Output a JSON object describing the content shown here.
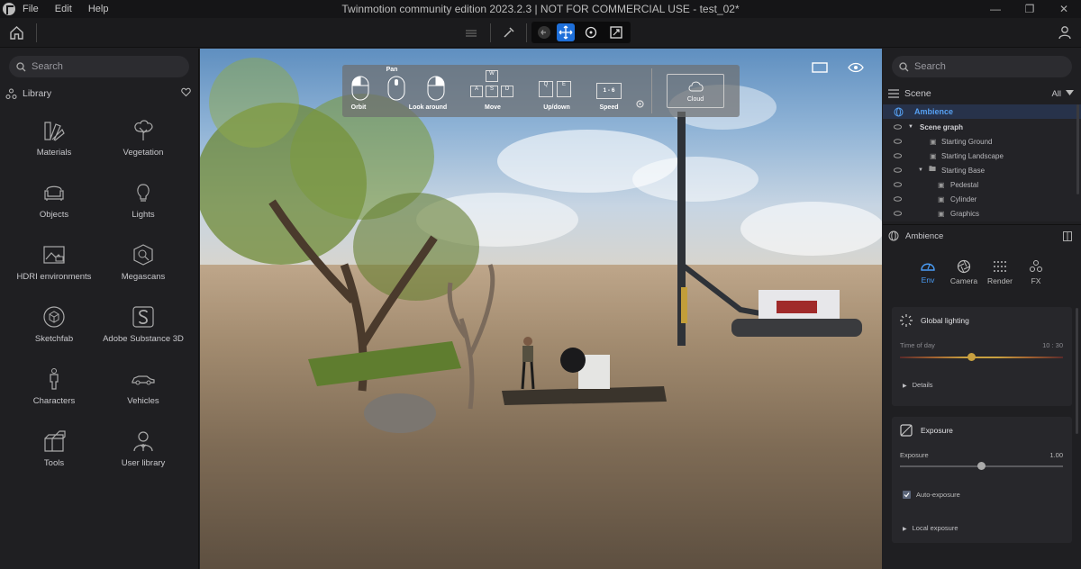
{
  "menu": {
    "file": "File",
    "edit": "Edit",
    "help": "Help"
  },
  "window": {
    "title": "Twinmotion community edition 2023.2.3 | NOT FOR COMMERCIAL USE - test_02*"
  },
  "library": {
    "search_placeholder": "Search",
    "title": "Library",
    "items": [
      {
        "label": "Materials",
        "icon": "swatch-icon"
      },
      {
        "label": "Vegetation",
        "icon": "tree-icon"
      },
      {
        "label": "Objects",
        "icon": "sofa-icon"
      },
      {
        "label": "Lights",
        "icon": "bulb-icon"
      },
      {
        "label": "HDRI environments",
        "icon": "hdri-icon"
      },
      {
        "label": "Megascans",
        "icon": "megascans-icon"
      },
      {
        "label": "Sketchfab",
        "icon": "sketchfab-icon"
      },
      {
        "label": "Adobe Substance 3D",
        "icon": "substance-icon"
      },
      {
        "label": "Characters",
        "icon": "person-icon"
      },
      {
        "label": "Vehicles",
        "icon": "car-icon"
      },
      {
        "label": "Tools",
        "icon": "cubes-icon"
      },
      {
        "label": "User library",
        "icon": "user-library-icon"
      }
    ]
  },
  "navigation": {
    "pan": "Pan",
    "orbit": "Orbit",
    "look_around": "Look around",
    "move": "Move",
    "updown": "Up/down",
    "speed": "Speed",
    "speed_value": "1 - 6",
    "cloud": "Cloud",
    "keys": {
      "w": "W",
      "a": "A",
      "s": "S",
      "d": "D",
      "q": "Q",
      "e": "E"
    }
  },
  "scene": {
    "search_placeholder": "Search",
    "title": "Scene",
    "filter": "All",
    "ambience_row": "Ambience",
    "scene_graph": "Scene graph",
    "items": [
      "Starting Ground",
      "Starting Landscape",
      "Starting Base",
      "Pedestal",
      "Cylinder",
      "Graphics"
    ]
  },
  "ambience": {
    "title": "Ambience",
    "tabs": [
      "Env",
      "Camera",
      "Render",
      "FX"
    ],
    "active_tab": "Env",
    "global_lighting": "Global lighting",
    "time_of_day_label": "Time of day",
    "time_of_day_value": "10 : 30",
    "time_of_day_fraction": 0.44,
    "details": "Details",
    "exposure_section": "Exposure",
    "exposure_label": "Exposure",
    "exposure_value": "1.00",
    "exposure_fraction": 0.5,
    "auto_exposure": "Auto-exposure",
    "auto_exposure_checked": true,
    "local_exposure": "Local exposure"
  },
  "colors": {
    "accent": "#1e6fd9",
    "selected_text": "#56a0f2"
  }
}
